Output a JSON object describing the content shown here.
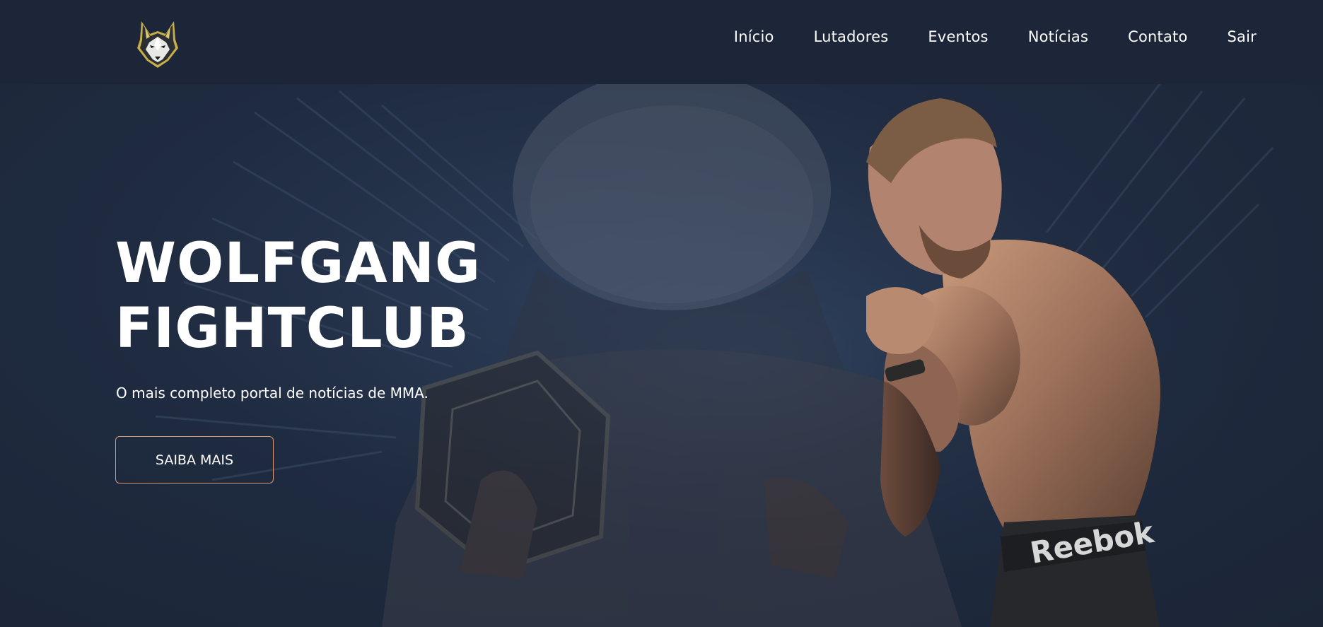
{
  "header": {
    "logo_alt": "Wolfgang Fightclub wolf logo",
    "nav": [
      {
        "label": "Início"
      },
      {
        "label": "Lutadores"
      },
      {
        "label": "Eventos"
      },
      {
        "label": "Notícias"
      },
      {
        "label": "Contato"
      },
      {
        "label": "Sair"
      }
    ]
  },
  "hero": {
    "title_line1": "WOLFGANG",
    "title_line2": "FIGHTCLUB",
    "subtitle": "O mais completo portal de notícias de MMA.",
    "cta_label": "SAIBA MAIS",
    "shorts_brand_text": "Reebok"
  },
  "colors": {
    "background": "#1f2a3e",
    "header_bg": "#1c2638",
    "cta_border": "#d9956e",
    "text": "#ffffff"
  }
}
